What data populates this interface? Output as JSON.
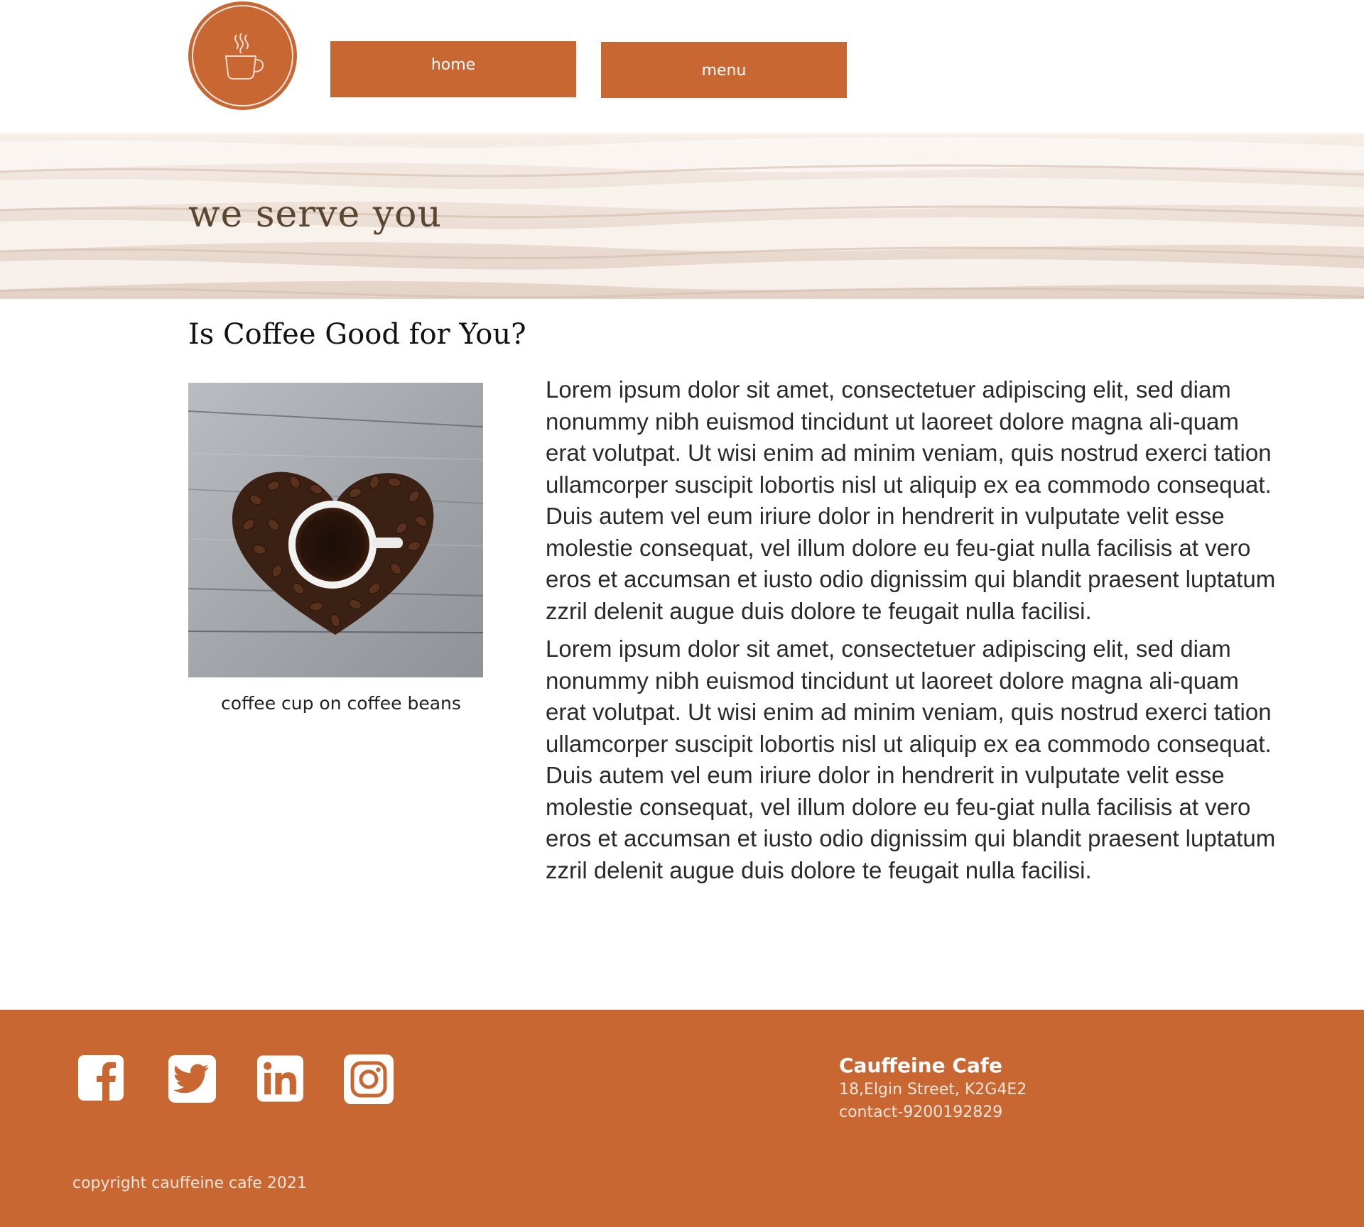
{
  "brand": {
    "logo_icon": "coffee-cup-icon",
    "accent_color": "#c96733"
  },
  "nav": {
    "home_label": "home",
    "menu_label": "menu"
  },
  "hero": {
    "title": "we serve you"
  },
  "article": {
    "title": "Is Coffee Good for You?",
    "image_caption": "coffee cup on coffee beans",
    "paragraphs": [
      "Lorem ipsum dolor sit amet, consectetuer adipiscing elit, sed diam nonummy nibh euismod tincidunt ut laoreet dolore magna ali-quam erat volutpat. Ut wisi enim ad minim veniam, quis nostrud exerci tation ullamcorper suscipit lobortis nisl ut aliquip ex ea commodo consequat. Duis autem vel eum iriure dolor in hendrerit in vulputate velit esse molestie consequat, vel illum dolore eu feu-giat nulla facilisis at vero eros et accumsan et iusto odio dignissim qui blandit praesent luptatum zzril delenit augue duis dolore te feugait nulla facilisi.",
      "Lorem ipsum dolor sit amet, consectetuer adipiscing elit, sed diam nonummy nibh euismod tincidunt ut laoreet dolore magna ali-quam erat volutpat. Ut wisi enim ad minim veniam, quis nostrud exerci tation ullamcorper suscipit lobortis nisl ut aliquip ex ea commodo consequat. Duis autem vel eum iriure dolor in hendrerit in vulputate velit esse molestie consequat, vel illum dolore eu feu-giat nulla facilisis at vero eros et accumsan et iusto odio dignissim qui blandit praesent luptatum zzril delenit augue duis dolore te feugait nulla facilisi."
    ]
  },
  "footer": {
    "social_icons": [
      "facebook-icon",
      "twitter-icon",
      "linkedin-icon",
      "instagram-icon"
    ],
    "cafe_name": "Cauffeine Cafe",
    "address": "18,Elgin Street, K2G4E2",
    "contact": "contact-9200192829",
    "copyright": "copyright cauffeine cafe 2021"
  }
}
